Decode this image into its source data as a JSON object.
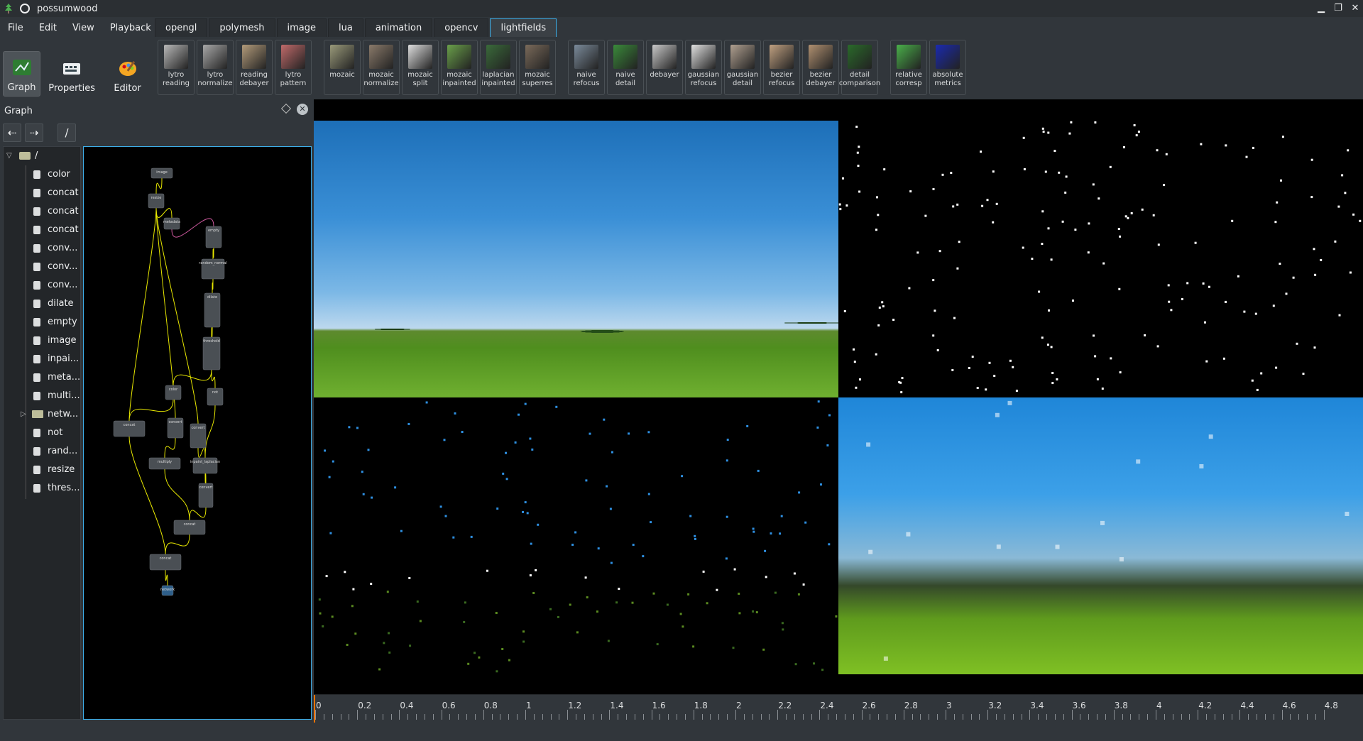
{
  "window": {
    "title": "possumwood"
  },
  "menu": [
    "File",
    "Edit",
    "View",
    "Playback"
  ],
  "tabs": [
    {
      "label": "opengl",
      "active": false
    },
    {
      "label": "polymesh",
      "active": false
    },
    {
      "label": "image",
      "active": false
    },
    {
      "label": "lua",
      "active": false
    },
    {
      "label": "animation",
      "active": false
    },
    {
      "label": "opencv",
      "active": false
    },
    {
      "label": "lightfields",
      "active": true
    }
  ],
  "modes": [
    {
      "label": "Graph",
      "icon": "graph-icon",
      "active": true
    },
    {
      "label": "Properties",
      "icon": "properties-icon",
      "active": false
    },
    {
      "label": "Editor",
      "icon": "editor-icon",
      "active": false
    }
  ],
  "toolbar": [
    [
      {
        "label": "lytro\nreading",
        "color": "#b8b8b8"
      },
      {
        "label": "lytro\nnormalize",
        "color": "#a8a8a8"
      },
      {
        "label": "reading\ndebayer",
        "color": "#b39b7a"
      },
      {
        "label": "lytro\npattern",
        "color": "#c06a6a"
      }
    ],
    [
      {
        "label": "mozaic",
        "color": "#9a9a7a"
      },
      {
        "label": "mozaic\nnormalize",
        "color": "#8a7a6a"
      },
      {
        "label": "mozaic\nsplit",
        "color": "#dddddd"
      },
      {
        "label": "mozaic\ninpainted",
        "color": "#6aa04a"
      },
      {
        "label": "laplacian\ninpainted",
        "color": "#3a6a3a"
      },
      {
        "label": "mozaic\nsuperres",
        "color": "#7a6a5a"
      }
    ],
    [
      {
        "label": "naive\nrefocus",
        "color": "#7a8a9a"
      },
      {
        "label": "naive\ndetail",
        "color": "#3a8a3a"
      },
      {
        "label": "debayer",
        "color": "#c8c8c8"
      },
      {
        "label": "gaussian\nrefocus",
        "color": "#e0e0e0"
      },
      {
        "label": "gaussian\ndetail",
        "color": "#b0a090"
      },
      {
        "label": "bezier\nrefocus",
        "color": "#c0a080"
      },
      {
        "label": "bezier\ndebayer",
        "color": "#b09070"
      },
      {
        "label": "detail\ncomparison",
        "color": "#2a6a2a"
      }
    ],
    [
      {
        "label": "relative\ncorresp",
        "color": "#4ab04a"
      },
      {
        "label": "absolute\nmetrics",
        "color": "#1a2ab0"
      }
    ]
  ],
  "dock": {
    "title": "Graph",
    "back_icon": "⇠",
    "forward_icon": "⇢",
    "path": "/"
  },
  "tree": {
    "root": "/",
    "items": [
      {
        "label": "color",
        "type": "file"
      },
      {
        "label": "concat",
        "type": "file"
      },
      {
        "label": "concat",
        "type": "file"
      },
      {
        "label": "concat",
        "type": "file"
      },
      {
        "label": "conv...",
        "type": "file"
      },
      {
        "label": "conv...",
        "type": "file"
      },
      {
        "label": "conv...",
        "type": "file"
      },
      {
        "label": "dilate",
        "type": "file"
      },
      {
        "label": "empty",
        "type": "file"
      },
      {
        "label": "image",
        "type": "file"
      },
      {
        "label": "inpai...",
        "type": "file"
      },
      {
        "label": "meta...",
        "type": "file"
      },
      {
        "label": "multi...",
        "type": "file"
      },
      {
        "label": "netw...",
        "type": "folder"
      },
      {
        "label": "not",
        "type": "file"
      },
      {
        "label": "rand...",
        "type": "file"
      },
      {
        "label": "resize",
        "type": "file"
      },
      {
        "label": "thres...",
        "type": "file"
      }
    ]
  },
  "graph_nodes": [
    {
      "label": "image"
    },
    {
      "label": "resize"
    },
    {
      "label": "metadata"
    },
    {
      "label": "empty"
    },
    {
      "label": "random_normal"
    },
    {
      "label": "dilate"
    },
    {
      "label": "threshold"
    },
    {
      "label": "color"
    },
    {
      "label": "not"
    },
    {
      "label": "concat"
    },
    {
      "label": "convert"
    },
    {
      "label": "convert"
    },
    {
      "label": "multiply"
    },
    {
      "label": "inpaint_laplacian"
    },
    {
      "label": "convert"
    },
    {
      "label": "concat"
    },
    {
      "label": "concat"
    },
    {
      "label": "network"
    }
  ],
  "timeline": {
    "ticks": [
      "0",
      "0.2",
      "0.4",
      "0.6",
      "0.8",
      "1",
      "1.2",
      "1.4",
      "1.6",
      "1.8",
      "2",
      "2.2",
      "2.4",
      "2.6",
      "2.8",
      "3",
      "3.2",
      "3.4",
      "3.6",
      "3.8",
      "4",
      "4.2",
      "4.4",
      "4.6",
      "4.8"
    ]
  },
  "colors": {
    "accent": "#3daee9",
    "wire": "#e6e600",
    "cursor": "#f67400"
  }
}
